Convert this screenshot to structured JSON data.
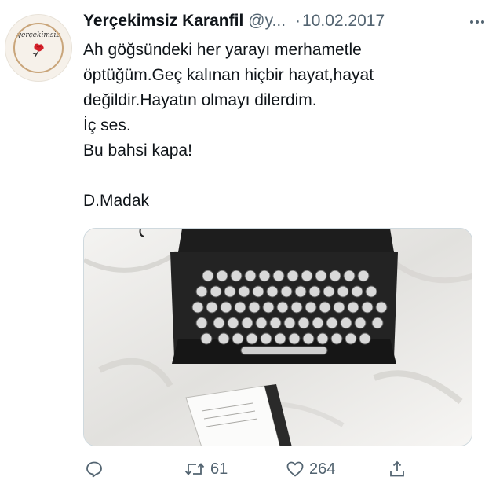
{
  "tweet": {
    "author_name": "Yerçekimsiz Karanfil",
    "handle": "@y...",
    "separator": "·",
    "date": "10.02.2017",
    "avatar_text": "yerçekimsiz",
    "lines": [
      "Ah göğsündeki her yarayı merhametle",
      "öptüğüm.Geç kalınan hiçbir hayat,hayat",
      "değildir.Hayatın olmayı dilerdim.",
      "İç ses.",
      "Bu bahsi kapa!",
      "",
      "D.Madak"
    ],
    "media": {
      "icon": "typewriter-photo"
    },
    "actions": {
      "reply_icon": "reply-icon",
      "retweet_icon": "retweet-icon",
      "retweet_count": "61",
      "like_icon": "heart-icon",
      "like_count": "264",
      "share_icon": "share-icon"
    }
  }
}
